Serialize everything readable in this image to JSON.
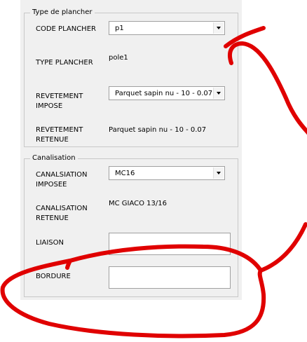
{
  "type_plancher_group": {
    "legend": "Type de plancher",
    "code_plancher_label": "CODE PLANCHER",
    "code_plancher_value": "p1",
    "type_plancher_label": "TYPE PLANCHER",
    "type_plancher_value": "pole1",
    "revetement_impose_label_1": "REVETEMENT",
    "revetement_impose_label_2": "IMPOSE",
    "revetement_impose_value": "Parquet sapin nu - 10 - 0.07",
    "revetement_retenue_label_1": "REVETEMENT",
    "revetement_retenue_label_2": "RETENUE",
    "revetement_retenue_value": "Parquet sapin nu - 10 - 0.07"
  },
  "canalisation_group": {
    "legend": "Canalisation",
    "canalisation_imposee_label_1": "CANALSIATION",
    "canalisation_imposee_label_2": "IMPOSEE",
    "canalisation_imposee_value": "MC16",
    "canalisation_retenue_label_1": "CANALISATION",
    "canalisation_retenue_label_2": "RETENUE",
    "canalisation_retenue_value": "MC GIACO 13/16",
    "liaison_label": "LIAISON",
    "liaison_value": "",
    "bordure_label": "BORDURE",
    "bordure_value": ""
  },
  "colors": {
    "panel": "#f0f0f0",
    "annotation": "#e00000"
  }
}
